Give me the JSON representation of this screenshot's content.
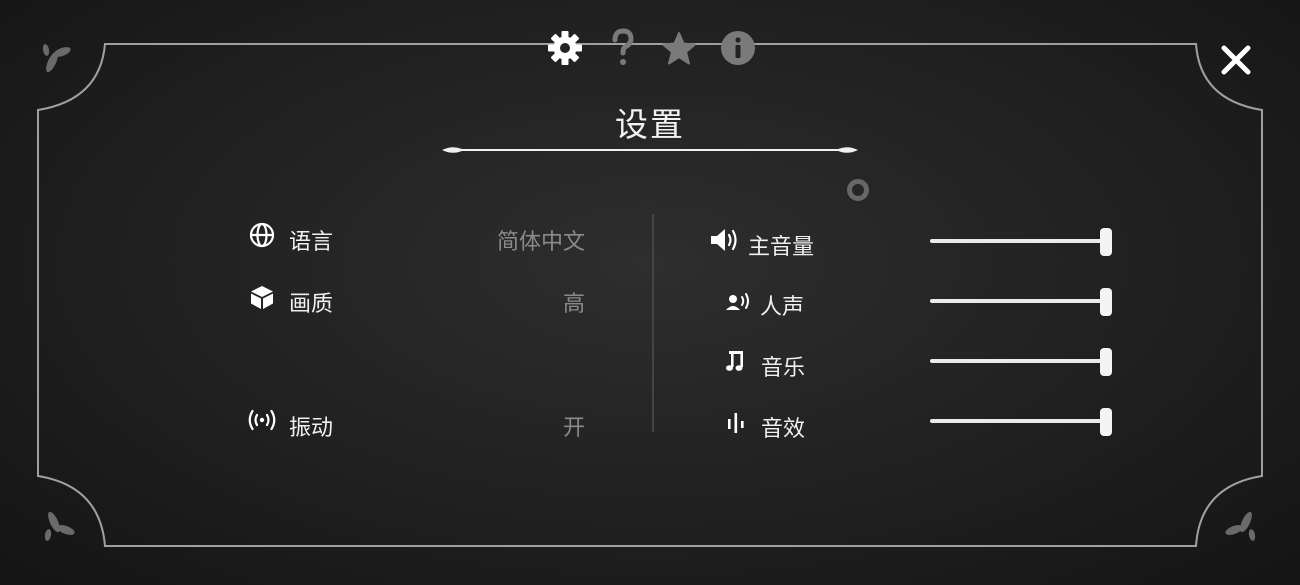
{
  "tabs": [
    {
      "icon": "gear-icon",
      "state": "active"
    },
    {
      "icon": "question-icon",
      "state": "inactive"
    },
    {
      "icon": "star-icon",
      "state": "inactive"
    },
    {
      "icon": "info-icon",
      "state": "inactive"
    }
  ],
  "title": "设置",
  "general": [
    {
      "icon": "globe-icon",
      "label": "语言",
      "value": "简体中文"
    },
    {
      "icon": "cube-icon",
      "label": "画质",
      "value": "高"
    },
    {
      "icon": "vibration-icon",
      "label": "振动",
      "value": "开"
    }
  ],
  "audio": [
    {
      "icon": "speaker-icon",
      "label": "主音量",
      "level": 1.0
    },
    {
      "icon": "voice-icon",
      "label": "人声",
      "level": 1.0
    },
    {
      "icon": "music-note-icon",
      "label": "音乐",
      "level": 1.0
    },
    {
      "icon": "sound-effect-icon",
      "label": "音效",
      "level": 1.0
    }
  ],
  "colors": {
    "active_tab": "#ffffff",
    "inactive_tab": "#7a7a7a",
    "value_text": "#8a8a8a",
    "frame": "#9a9a9a"
  }
}
